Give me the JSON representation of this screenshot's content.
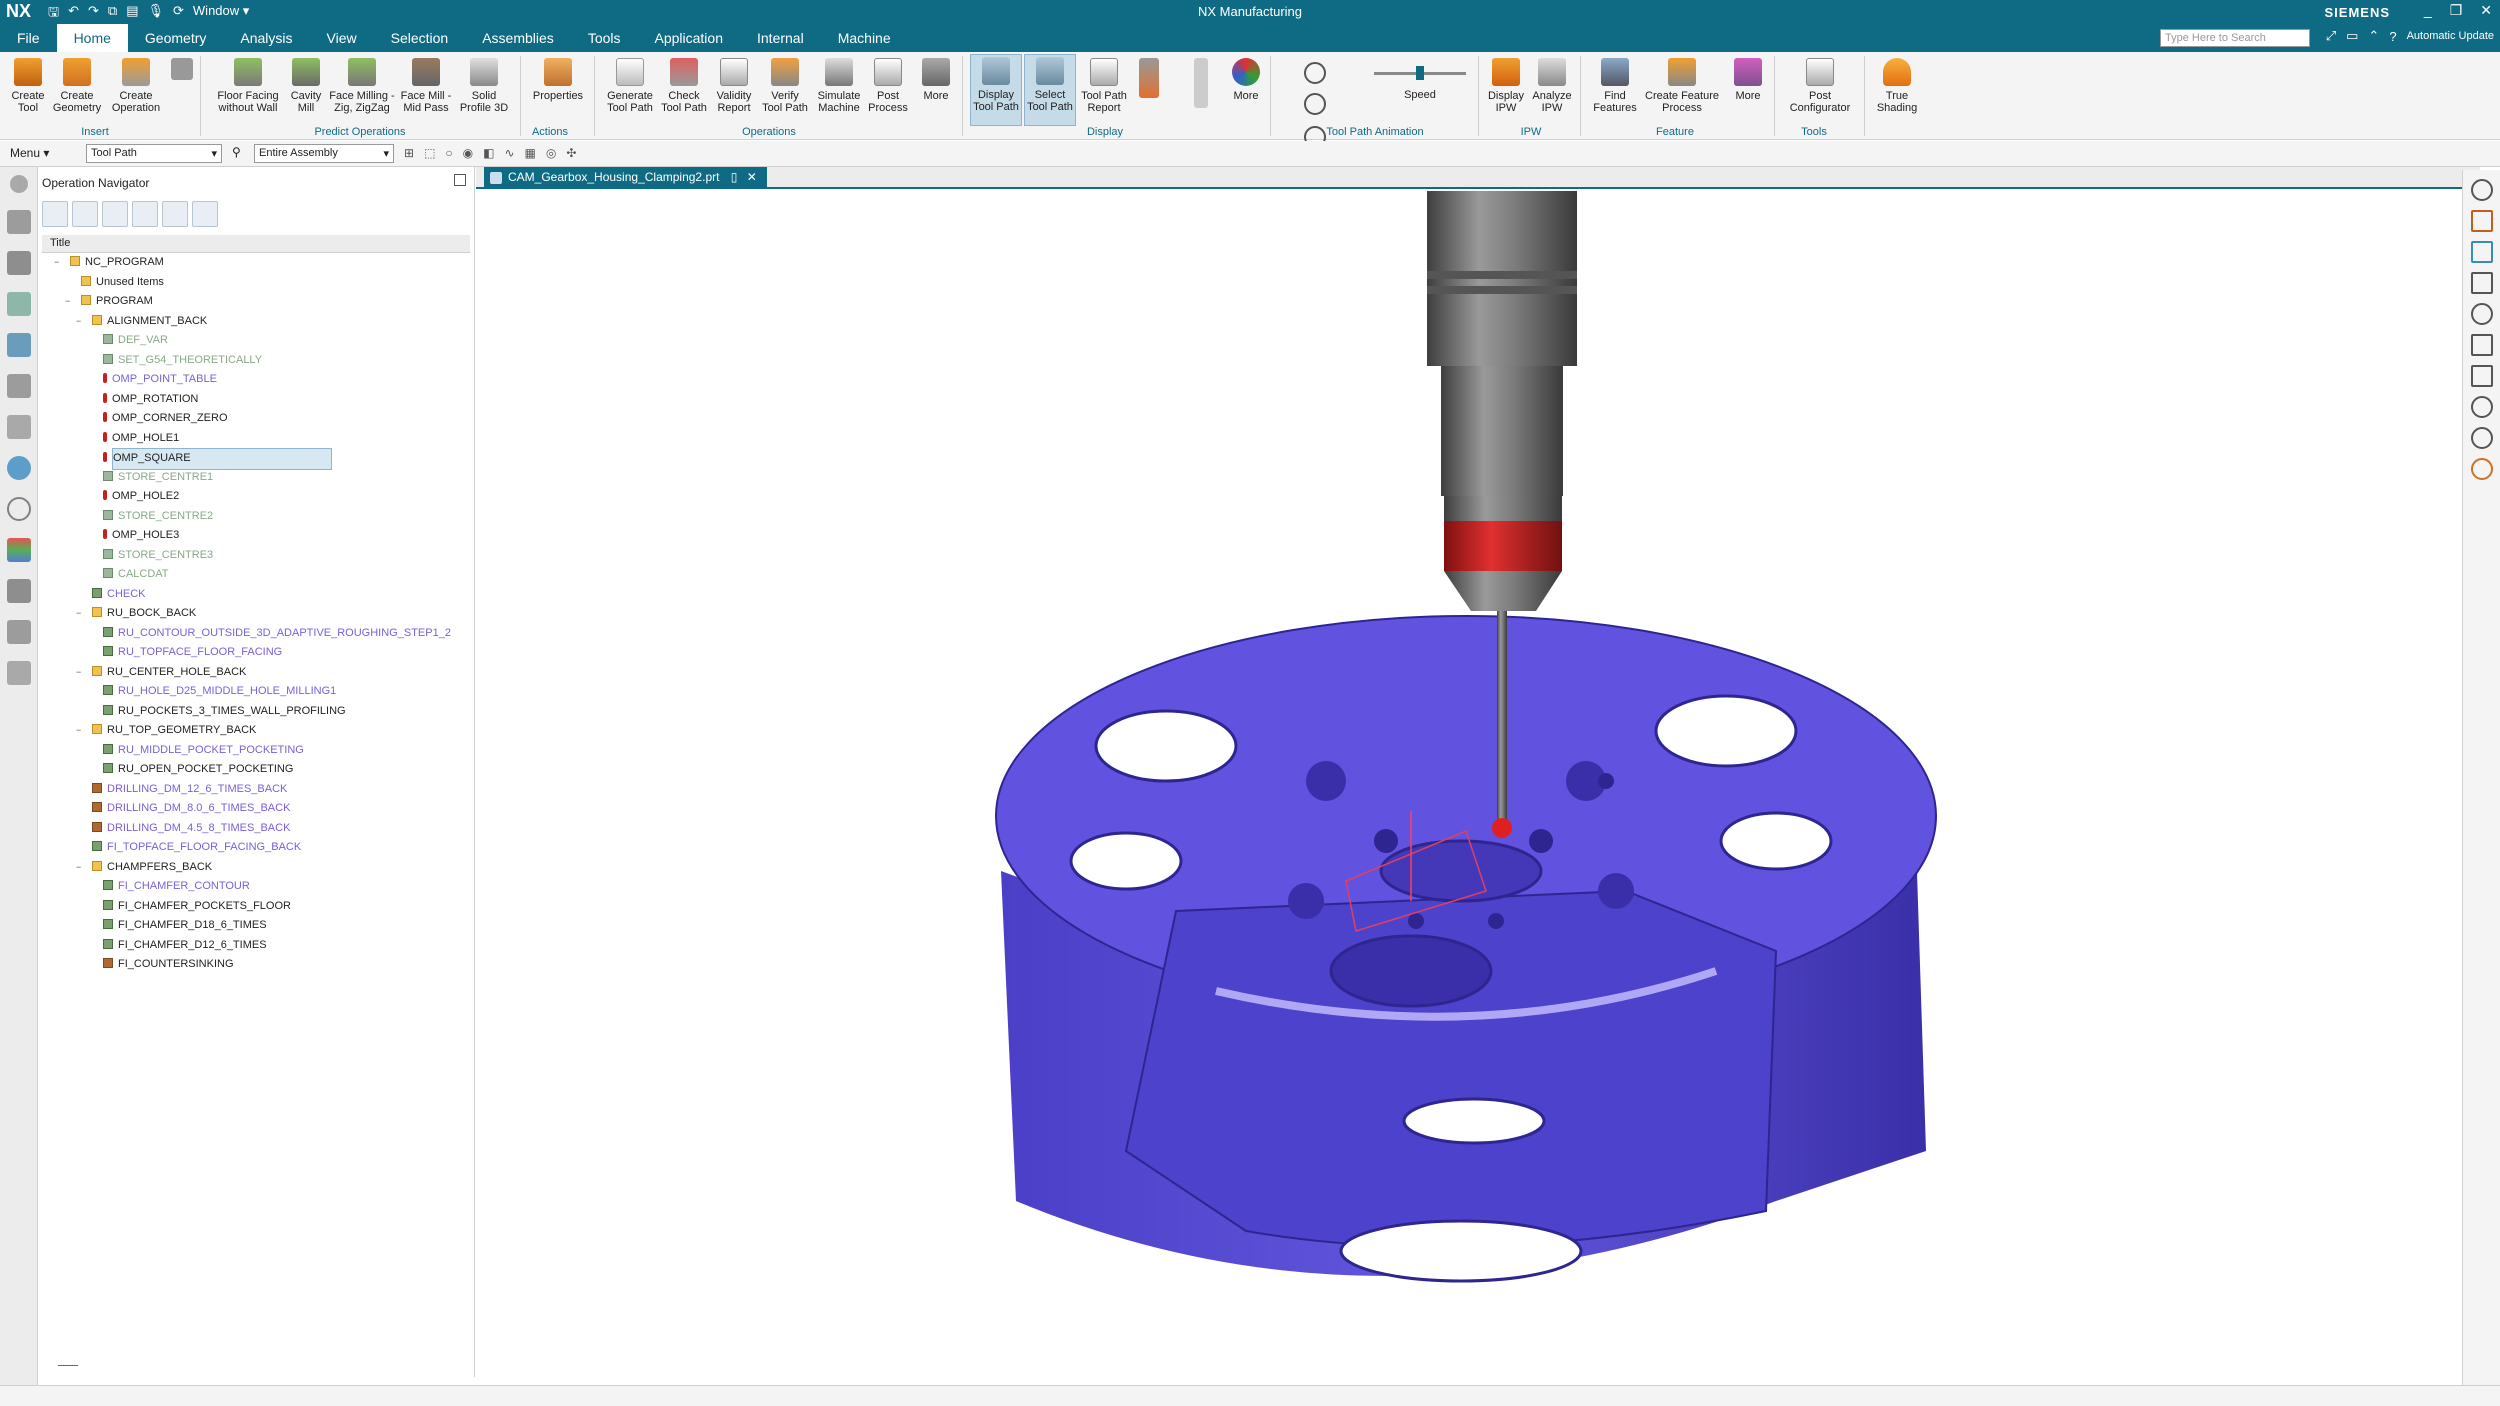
{
  "title_bar": {
    "logo": "NX",
    "window_menu": "Window ▾",
    "app_title": "NX Manufacturing",
    "brand": "SIEMENS",
    "controls": [
      "_",
      "❐",
      "✕"
    ]
  },
  "menu_bar": {
    "tabs": [
      "File",
      "Home",
      "Geometry",
      "Analysis",
      "View",
      "Selection",
      "Assemblies",
      "Tools",
      "Application",
      "Internal",
      "Machine"
    ],
    "active_tab": "Home",
    "search_placeholder": "Type Here to Search",
    "update_label": "Automatic Update"
  },
  "ribbon": {
    "buttons": {
      "create_tool": "Create Tool",
      "create_geometry": "Create Geometry",
      "create_operation": "Create Operation",
      "floor_facing": "Floor Facing without Wall",
      "cavity_mill": "Cavity Mill",
      "face_milling": "Face Milling - Zig, ZigZag",
      "face_mill_mid": "Face Mill - Mid Pass",
      "solid_profile": "Solid Profile 3D",
      "properties": "Properties",
      "generate_tool_path": "Generate Tool Path",
      "check_tool_path": "Check Tool Path",
      "validity_report": "Validity Report",
      "verify_tool_path": "Verify Tool Path",
      "simulate_machine": "Simulate Machine",
      "post_process": "Post Process",
      "more_ops": "More",
      "display_tool_path": "Display Tool Path",
      "select_tool_path": "Select Tool Path",
      "tool_path_report": "Tool Path Report",
      "more_display": "More",
      "speed": "Speed",
      "display_ipw": "Display IPW",
      "analyze_ipw": "Analyze IPW",
      "find_features": "Find Features",
      "create_feature_process": "Create Feature Process",
      "more_feature": "More",
      "post_configurator": "Post Configurator",
      "true_shading": "True Shading"
    },
    "groups": {
      "insert": "Insert",
      "predict_operations": "Predict Operations",
      "actions": "Actions",
      "operations": "Operations",
      "display": "Display",
      "tool_path_animation": "Tool Path Animation",
      "ipw": "IPW",
      "feature": "Feature",
      "tools": "Tools"
    }
  },
  "toolbar2": {
    "menu_label": "Menu ▾",
    "filter_value": "Tool Path",
    "scope_value": "Entire Assembly"
  },
  "navigator": {
    "title": "Operation Navigator",
    "column_title": "Title",
    "tree": [
      {
        "label": "NC_PROGRAM",
        "level": 0,
        "color": "#222",
        "icon": "folder",
        "expander": "−"
      },
      {
        "label": "Unused Items",
        "level": 1,
        "color": "#222",
        "icon": "folder",
        "expander": ""
      },
      {
        "label": "PROGRAM",
        "level": 1,
        "color": "#222",
        "icon": "folder",
        "expander": "−"
      },
      {
        "label": "ALIGNMENT_BACK",
        "level": 2,
        "color": "#222",
        "icon": "folder",
        "expander": "−"
      },
      {
        "label": "DEF_VAR",
        "level": 3,
        "color": "#8aa88a",
        "icon": "op-grid",
        "expander": ""
      },
      {
        "label": "SET_G54_THEORETICALLY",
        "level": 3,
        "color": "#8aa88a",
        "icon": "op-grid",
        "expander": ""
      },
      {
        "label": "OMP_POINT_TABLE",
        "level": 3,
        "color": "#7b5fd8",
        "icon": "probe",
        "expander": ""
      },
      {
        "label": "OMP_ROTATION",
        "level": 3,
        "color": "#222",
        "icon": "probe",
        "expander": ""
      },
      {
        "label": "OMP_CORNER_ZERO",
        "level": 3,
        "color": "#222",
        "icon": "probe",
        "expander": ""
      },
      {
        "label": "OMP_HOLE1",
        "level": 3,
        "color": "#222",
        "icon": "probe",
        "expander": ""
      },
      {
        "label": "OMP_SQUARE",
        "level": 3,
        "color": "#222",
        "icon": "probe",
        "expander": "",
        "selected": true
      },
      {
        "label": "STORE_CENTRE1",
        "level": 3,
        "color": "#8aa88a",
        "icon": "op-grid",
        "expander": ""
      },
      {
        "label": "OMP_HOLE2",
        "level": 3,
        "color": "#222",
        "icon": "probe",
        "expander": ""
      },
      {
        "label": "STORE_CENTRE2",
        "level": 3,
        "color": "#8aa88a",
        "icon": "op-grid",
        "expander": ""
      },
      {
        "label": "OMP_HOLE3",
        "level": 3,
        "color": "#222",
        "icon": "probe",
        "expander": ""
      },
      {
        "label": "STORE_CENTRE3",
        "level": 3,
        "color": "#8aa88a",
        "icon": "op-grid",
        "expander": ""
      },
      {
        "label": "CALCDAT",
        "level": 3,
        "color": "#8aa88a",
        "icon": "op-grid",
        "expander": ""
      },
      {
        "label": "CHECK",
        "level": 2,
        "color": "#7b5fd8",
        "icon": "op-mill",
        "expander": ""
      },
      {
        "label": "RU_BOCK_BACK",
        "level": 2,
        "color": "#222",
        "icon": "folder",
        "expander": "−"
      },
      {
        "label": "RU_CONTOUR_OUTSIDE_3D_ADAPTIVE_ROUGHING_STEP1_2",
        "level": 3,
        "color": "#7b5fd8",
        "icon": "op-mill",
        "expander": ""
      },
      {
        "label": "RU_TOPFACE_FLOOR_FACING",
        "level": 3,
        "color": "#7b5fd8",
        "icon": "op-mill",
        "expander": ""
      },
      {
        "label": "RU_CENTER_HOLE_BACK",
        "level": 2,
        "color": "#222",
        "icon": "folder",
        "expander": "−"
      },
      {
        "label": "RU_HOLE_D25_MIDDLE_HOLE_MILLING1",
        "level": 3,
        "color": "#7b5fd8",
        "icon": "op-mill",
        "expander": ""
      },
      {
        "label": "RU_POCKETS_3_TIMES_WALL_PROFILING",
        "level": 3,
        "color": "#222",
        "icon": "op-mill",
        "expander": ""
      },
      {
        "label": "RU_TOP_GEOMETRY_BACK",
        "level": 2,
        "color": "#222",
        "icon": "folder",
        "expander": "−"
      },
      {
        "label": "RU_MIDDLE_POCKET_POCKETING",
        "level": 3,
        "color": "#7b5fd8",
        "icon": "op-mill",
        "expander": ""
      },
      {
        "label": "RU_OPEN_POCKET_POCKETING",
        "level": 3,
        "color": "#222",
        "icon": "op-mill",
        "expander": ""
      },
      {
        "label": "DRILLING_DM_12_6_TIMES_BACK",
        "level": 2,
        "color": "#7b5fd8",
        "icon": "op-drill",
        "expander": ""
      },
      {
        "label": "DRILLING_DM_8.0_6_TIMES_BACK",
        "level": 2,
        "color": "#7b5fd8",
        "icon": "op-drill",
        "expander": ""
      },
      {
        "label": "DRILLING_DM_4.5_8_TIMES_BACK",
        "level": 2,
        "color": "#7b5fd8",
        "icon": "op-drill",
        "expander": ""
      },
      {
        "label": "FI_TOPFACE_FLOOR_FACING_BACK",
        "level": 2,
        "color": "#7b5fd8",
        "icon": "op-mill",
        "expander": ""
      },
      {
        "label": "CHAMPFERS_BACK",
        "level": 2,
        "color": "#222",
        "icon": "folder",
        "expander": "−"
      },
      {
        "label": "FI_CHAMFER_CONTOUR",
        "level": 3,
        "color": "#7b5fd8",
        "icon": "op-mill",
        "expander": ""
      },
      {
        "label": "FI_CHAMFER_POCKETS_FLOOR",
        "level": 3,
        "color": "#222",
        "icon": "op-mill",
        "expander": ""
      },
      {
        "label": "FI_CHAMFER_D18_6_TIMES",
        "level": 3,
        "color": "#222",
        "icon": "op-mill",
        "expander": ""
      },
      {
        "label": "FI_CHAMFER_D12_6_TIMES",
        "level": 3,
        "color": "#222",
        "icon": "op-mill",
        "expander": ""
      },
      {
        "label": "FI_COUNTERSINKING",
        "level": 3,
        "color": "#222",
        "icon": "op-drill",
        "expander": ""
      }
    ]
  },
  "document": {
    "tab_label": "CAM_Gearbox_Housing_Clamping2.prt"
  },
  "colors": {
    "accent": "#0f6b84",
    "part": "#5a4fd6",
    "part_dark": "#3a2fa8",
    "probe_red": "#d32020",
    "spindle": "#6a6a6a"
  }
}
